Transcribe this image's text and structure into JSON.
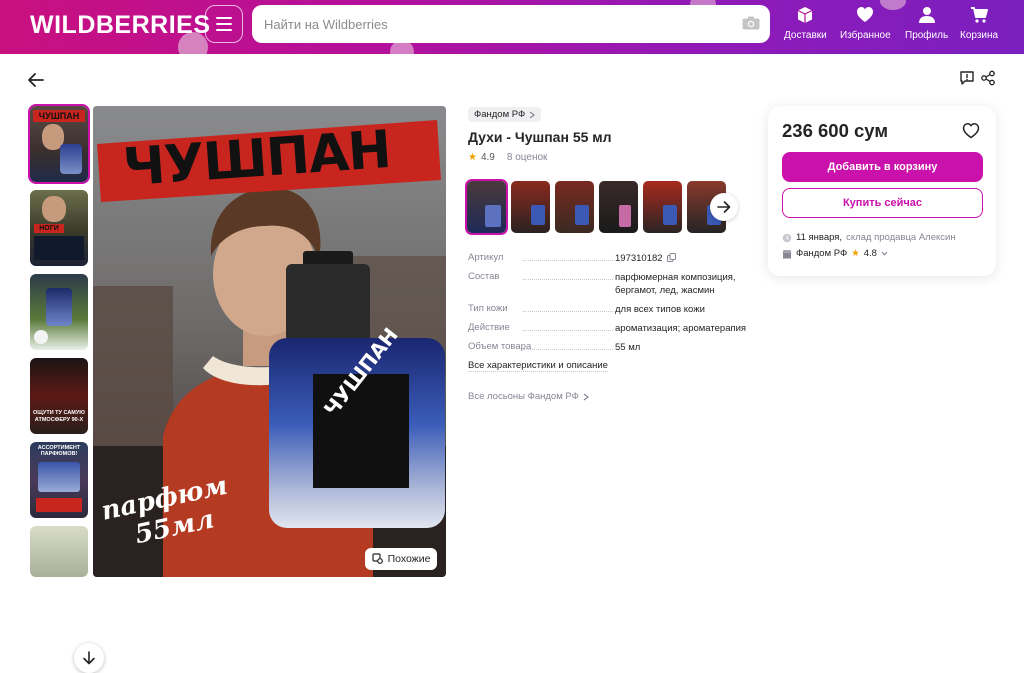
{
  "header": {
    "logo": "WILDBERRIES",
    "search_placeholder": "Найти на Wildberries",
    "nav": [
      {
        "label": "Доставки",
        "icon": "box-icon"
      },
      {
        "label": "Избранное",
        "icon": "heart-icon"
      },
      {
        "label": "Профиль",
        "icon": "user-icon"
      },
      {
        "label": "Корзина",
        "icon": "cart-icon"
      }
    ]
  },
  "product": {
    "brand": "Фандом РФ",
    "title": "Духи - Чушпан 55 мл",
    "rating": "4.9",
    "reviews": "8 оценок",
    "image_text": {
      "headline": "ЧУШПАН",
      "caption_line1": "парфюм",
      "caption_line2": "55мл",
      "label": "ЧУШПАН"
    },
    "similar_label": "Похожие",
    "thumb_texts": [
      "ЧУШПАН",
      "НОГИ",
      "",
      "ОЩУТИ ТУ САМУЮ АТМОСФЕРУ 90-Х",
      "АССОРТИМЕНТ ПАРФЮМОВ!",
      ""
    ],
    "specs": [
      {
        "key": "Артикул",
        "value": "197310182"
      },
      {
        "key": "Состав",
        "value": "парфюмерная композиция, бергамот, лед, жасмин"
      },
      {
        "key": "Тип кожи",
        "value": "для всех типов кожи"
      },
      {
        "key": "Действие",
        "value": "ароматизация; ароматерапия"
      },
      {
        "key": "Объем товара",
        "value": "55 мл"
      }
    ],
    "all_specs_link": "Все характеристики и описание",
    "all_lotions_link": "Все лосьоны Фандом РФ"
  },
  "price_card": {
    "price": "236 600 сум",
    "add_to_cart": "Добавить в корзину",
    "buy_now": "Купить сейчас",
    "delivery_date": "11 января,",
    "delivery_text": "склад продавца Алексин",
    "seller_name": "Фандом РФ",
    "seller_rating": "4.8"
  },
  "colors": {
    "accent": "#cb11ab",
    "header_start": "#c9107f",
    "header_end": "#7b1fbf",
    "star": "#f0a200"
  }
}
